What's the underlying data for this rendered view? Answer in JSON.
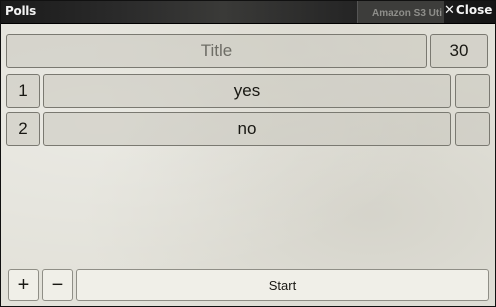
{
  "window": {
    "title": "Polls",
    "background_tab_label": "Amazon S3 Uti",
    "close_label": "Close",
    "close_glyph": "✕"
  },
  "poll": {
    "title_placeholder": "Title",
    "duration": "30",
    "options": [
      {
        "number": "1",
        "text": "yes",
        "extra": ""
      },
      {
        "number": "2",
        "text": "no",
        "extra": ""
      }
    ]
  },
  "controls": {
    "add_label": "+",
    "remove_label": "−",
    "start_label": "Start"
  }
}
